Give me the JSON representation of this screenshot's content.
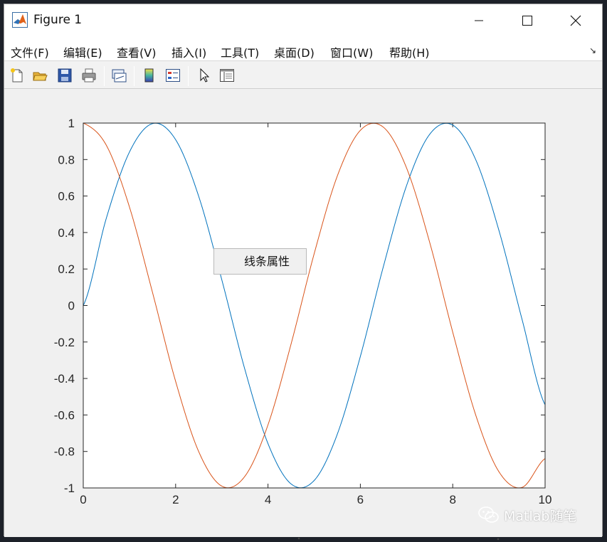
{
  "window": {
    "title": "Figure 1"
  },
  "menubar": {
    "items": [
      "文件(F)",
      "编辑(E)",
      "查看(V)",
      "插入(I)",
      "工具(T)",
      "桌面(D)",
      "窗口(W)",
      "帮助(H)"
    ],
    "overflow_glyph": "↘"
  },
  "toolbar": {
    "icons": [
      "new-figure-icon",
      "open-file-icon",
      "save-icon",
      "print-icon",
      "link-plot-icon",
      "colorbar-icon",
      "legend-icon",
      "pointer-icon",
      "property-inspector-icon"
    ]
  },
  "popup": {
    "label": "线条属性"
  },
  "watermark": {
    "text": "Matlab随笔"
  },
  "colors": {
    "series_sin": "#0072bd",
    "series_cos": "#d95319",
    "window_bg": "#f0f0f0"
  },
  "chart_data": {
    "type": "line",
    "title": "",
    "xlabel": "",
    "ylabel": "",
    "xlim": [
      0,
      10
    ],
    "ylim": [
      -1,
      1
    ],
    "xticks": [
      0,
      2,
      4,
      6,
      8,
      10
    ],
    "yticks": [
      -1,
      -0.8,
      -0.6,
      -0.4,
      -0.2,
      0,
      0.2,
      0.4,
      0.6,
      0.8,
      1
    ],
    "xtick_labels": [
      "0",
      "2",
      "4",
      "6",
      "8",
      "10"
    ],
    "ytick_labels": [
      "-1",
      "-0.8",
      "-0.6",
      "-0.4",
      "-0.2",
      "0",
      "0.2",
      "0.4",
      "0.6",
      "0.8",
      "1"
    ],
    "grid": false,
    "x": [
      0,
      0.5,
      1,
      1.5,
      2,
      2.5,
      3,
      3.5,
      4,
      4.5,
      5,
      5.5,
      6,
      6.5,
      7,
      7.5,
      8,
      8.5,
      9,
      9.5,
      10
    ],
    "series": [
      {
        "values": [
          0,
          0.479,
          0.841,
          0.997,
          0.909,
          0.598,
          0.141,
          -0.351,
          -0.757,
          -0.978,
          -0.959,
          -0.706,
          -0.279,
          0.215,
          0.657,
          0.938,
          0.989,
          0.798,
          0.412,
          -0.075,
          -0.544
        ]
      },
      {
        "values": [
          1,
          0.878,
          0.54,
          0.071,
          -0.416,
          -0.801,
          -0.99,
          -0.936,
          -0.654,
          -0.211,
          0.284,
          0.709,
          0.96,
          0.977,
          0.754,
          0.347,
          -0.146,
          -0.602,
          -0.911,
          -0.997,
          -0.839
        ]
      }
    ]
  }
}
